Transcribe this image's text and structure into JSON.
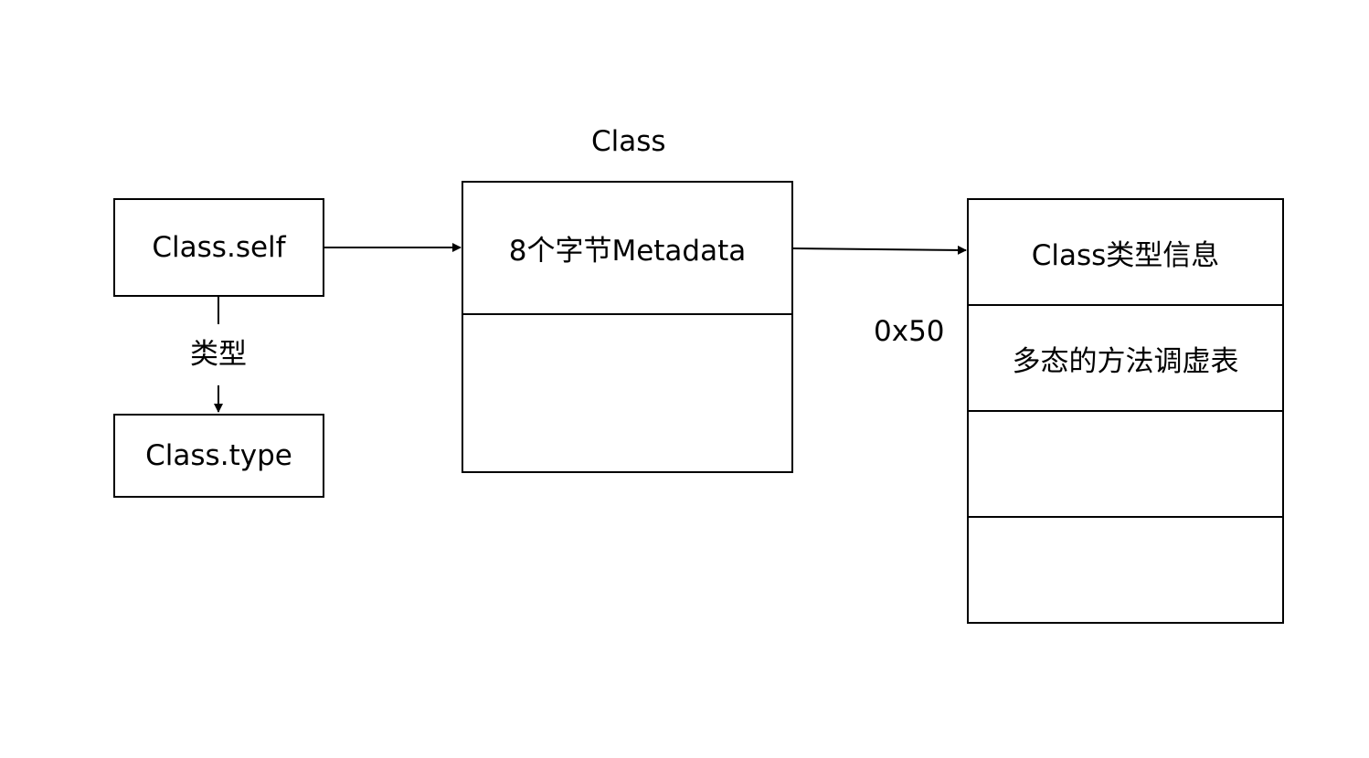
{
  "class_self_box": {
    "label": "Class.self"
  },
  "class_type_box": {
    "label": "Class.type"
  },
  "type_relation": {
    "label": "类型"
  },
  "class_struct": {
    "title": "Class",
    "cells": [
      {
        "label": "8个字节Metadata"
      },
      {
        "label": ""
      }
    ]
  },
  "offset": {
    "label": "0x50"
  },
  "metadata_struct": {
    "cells": [
      {
        "label": "Class类型信息"
      },
      {
        "label": "多态的方法调虚表"
      },
      {
        "label": ""
      },
      {
        "label": ""
      }
    ]
  },
  "colors": {
    "line": "#000000",
    "background": "#ffffff"
  }
}
